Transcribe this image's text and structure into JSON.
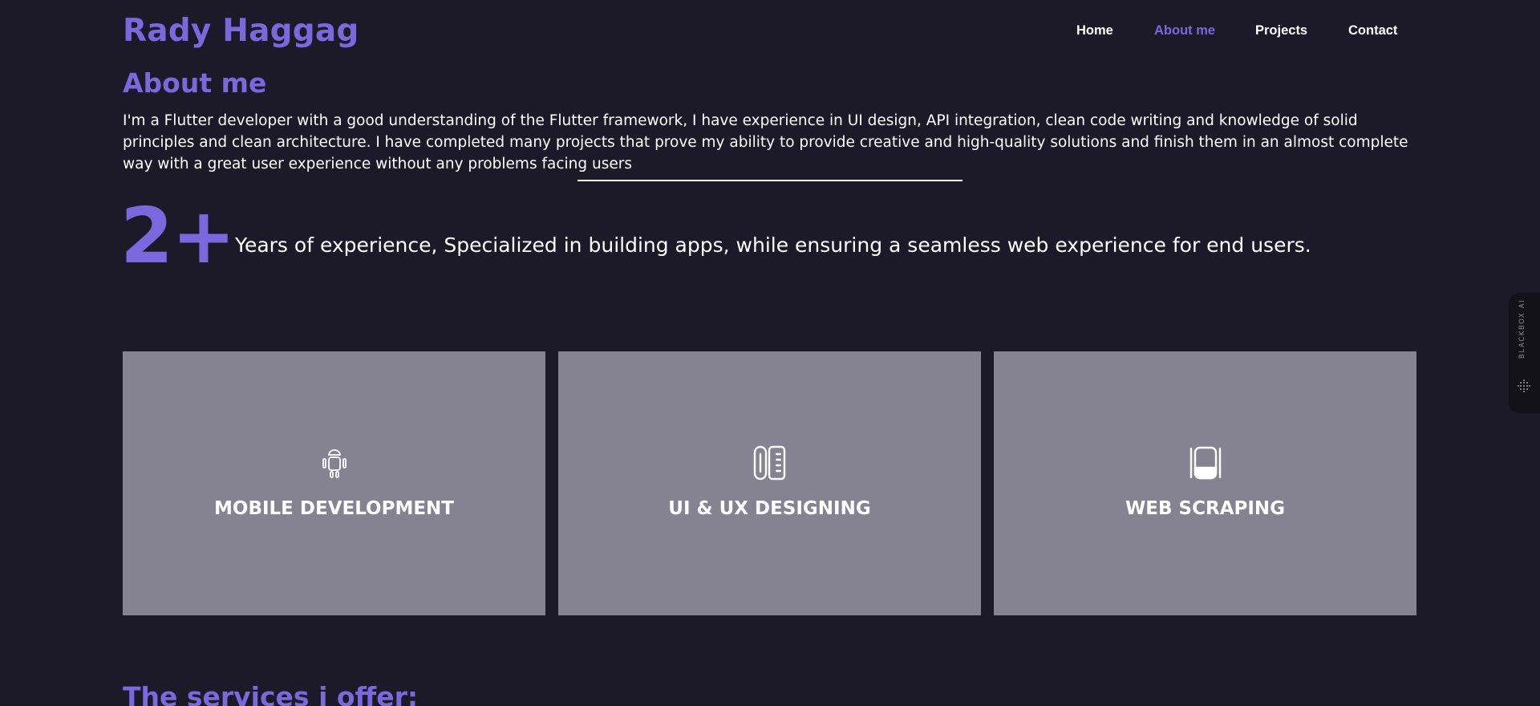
{
  "header": {
    "logo": "Rady Haggag",
    "nav": [
      {
        "label": "Home",
        "active": false
      },
      {
        "label": "About me",
        "active": true
      },
      {
        "label": "Projects",
        "active": false
      },
      {
        "label": "Contact",
        "active": false
      }
    ]
  },
  "about": {
    "title": "About me",
    "text": "I'm a Flutter developer with a good understanding of the Flutter framework, I have experience in UI design, API integration, clean code writing and knowledge of solid principles and clean architecture. I have completed many projects that prove my ability to provide creative and high-quality solutions and finish them in an almost complete way with a great user experience without any problems facing users"
  },
  "experience": {
    "number": "2+",
    "text": "Years of experience, Specialized in building apps, while ensuring a seamless web experience for end users."
  },
  "cards": [
    {
      "title": "MOBILE DEVELOPMENT",
      "icon": "android-robot-icon"
    },
    {
      "title": "UI & UX DESIGNING",
      "icon": "pen-ruler-icon"
    },
    {
      "title": "WEB SCRAPING",
      "icon": "spatula-scraper-icon"
    }
  ],
  "side_widget": {
    "label": "BLACKBOX AI",
    "icon": "dots-logo-icon"
  },
  "services": {
    "title": "The services i offer:"
  },
  "colors": {
    "accent": "#7a68dc",
    "background": "#1c1a29",
    "card": "#858391",
    "text": "#ffffff"
  }
}
